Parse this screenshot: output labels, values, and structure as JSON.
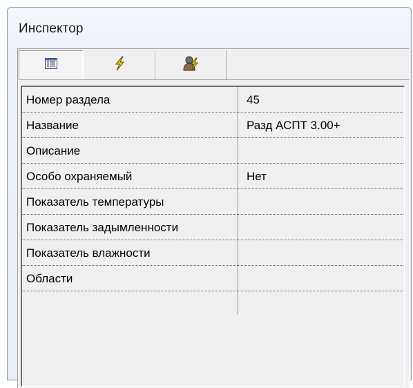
{
  "window": {
    "title": "Инспектор"
  },
  "tabs": [
    {
      "icon": "property-list-icon",
      "active": true
    },
    {
      "icon": "lightning-icon",
      "active": false
    },
    {
      "icon": "user-lightning-icon",
      "active": false
    }
  ],
  "properties": [
    {
      "name": "Номер раздела",
      "value": "45"
    },
    {
      "name": "Название",
      "value": "Разд АСПТ 3.00+"
    },
    {
      "name": "Описание",
      "value": ""
    },
    {
      "name": "Особо охраняемый",
      "value": "Нет"
    },
    {
      "name": "Показатель температуры",
      "value": ""
    },
    {
      "name": "Показатель задымленности",
      "value": ""
    },
    {
      "name": "Показатель влажности",
      "value": ""
    },
    {
      "name": "Области",
      "value": ""
    }
  ]
}
